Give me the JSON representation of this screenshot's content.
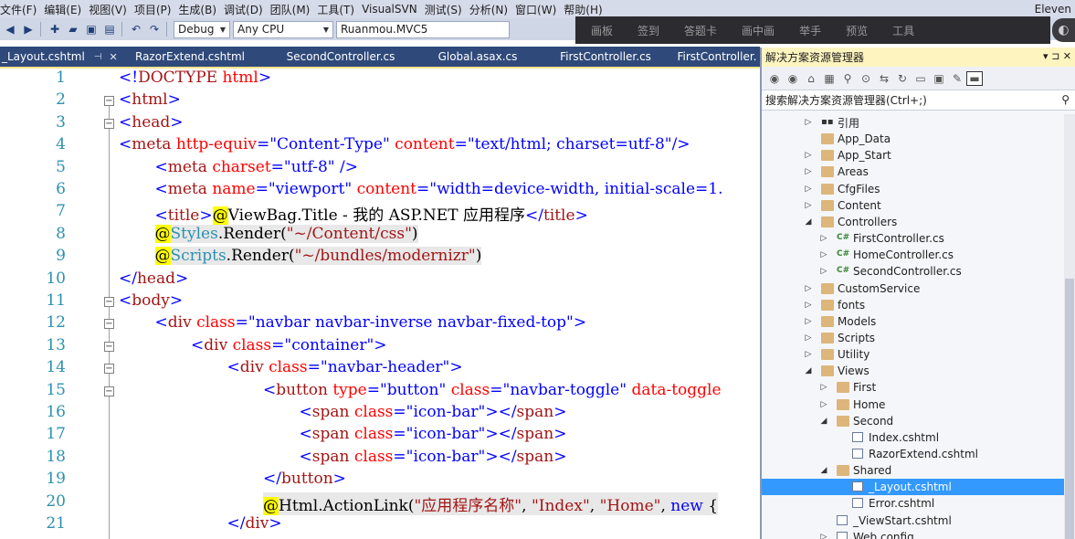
{
  "menu": {
    "items": [
      "文件(F)",
      "编辑(E)",
      "视图(V)",
      "项目(P)",
      "生成(B)",
      "调试(D)",
      "团队(M)",
      "工具(T)",
      "VisualSVN",
      "测试(S)",
      "分析(N)",
      "窗口(W)",
      "帮助(H)"
    ],
    "user": "Eleven"
  },
  "toolbar": {
    "config": "Debug",
    "platform": "Any CPU",
    "project": "Ruanmou.MVC5"
  },
  "overlay": {
    "items": [
      "画板",
      "签到",
      "答题卡",
      "画中画",
      "举手",
      "预览",
      "工具"
    ]
  },
  "tabs": [
    {
      "label": "_Layout.cshtml",
      "active": true
    },
    {
      "label": "RazorExtend.cshtml"
    },
    {
      "label": "SecondController.cs"
    },
    {
      "label": "Global.asax.cs"
    },
    {
      "label": "FirstController.cs"
    },
    {
      "label": "FirstController."
    }
  ],
  "editor": {
    "lines": [
      {
        "n": "1",
        "indent": 0,
        "fold": "",
        "tokens": [
          [
            "c-br",
            "<!"
          ],
          [
            "c-tag",
            "DOCTYPE"
          ],
          [
            "c-txt",
            " "
          ],
          [
            "c-attr",
            "html"
          ],
          [
            "c-br",
            ">"
          ]
        ]
      },
      {
        "n": "2",
        "indent": 0,
        "fold": "⊟",
        "tokens": [
          [
            "c-br",
            "<"
          ],
          [
            "c-tag",
            "html"
          ],
          [
            "c-br",
            ">"
          ]
        ]
      },
      {
        "n": "3",
        "indent": 0,
        "fold": "⊟",
        "tokens": [
          [
            "c-br",
            "<"
          ],
          [
            "c-tag",
            "head"
          ],
          [
            "c-br",
            ">"
          ]
        ]
      },
      {
        "n": "4",
        "indent": 0,
        "fold": "",
        "tokens": [
          [
            "c-br",
            "<"
          ],
          [
            "c-tag",
            "meta"
          ],
          [
            "c-txt",
            " "
          ],
          [
            "c-attr",
            "http-equiv"
          ],
          [
            "c-br",
            "="
          ],
          [
            "c-str",
            "\"Content-Type\""
          ],
          [
            "c-txt",
            " "
          ],
          [
            "c-attr",
            "content"
          ],
          [
            "c-br",
            "="
          ],
          [
            "c-str",
            "\"text/html; charset=utf-8\""
          ],
          [
            "c-br",
            "/>"
          ]
        ]
      },
      {
        "n": "5",
        "indent": 1,
        "fold": "",
        "tokens": [
          [
            "c-br",
            "<"
          ],
          [
            "c-tag",
            "meta"
          ],
          [
            "c-txt",
            " "
          ],
          [
            "c-attr",
            "charset"
          ],
          [
            "c-br",
            "="
          ],
          [
            "c-str",
            "\"utf-8\""
          ],
          [
            "c-txt",
            " "
          ],
          [
            "c-br",
            "/>"
          ]
        ]
      },
      {
        "n": "6",
        "indent": 1,
        "fold": "",
        "tokens": [
          [
            "c-br",
            "<"
          ],
          [
            "c-tag",
            "meta"
          ],
          [
            "c-txt",
            " "
          ],
          [
            "c-attr",
            "name"
          ],
          [
            "c-br",
            "="
          ],
          [
            "c-str",
            "\"viewport\""
          ],
          [
            "c-txt",
            " "
          ],
          [
            "c-attr",
            "content"
          ],
          [
            "c-br",
            "="
          ],
          [
            "c-str",
            "\"width=device-width, initial-scale=1."
          ]
        ]
      },
      {
        "n": "7",
        "indent": 1,
        "fold": "",
        "tokens": [
          [
            "c-br",
            "<"
          ],
          [
            "c-tag",
            "title"
          ],
          [
            "c-br",
            ">"
          ],
          [
            "c-at",
            "@"
          ],
          [
            "c-txt",
            "ViewBag.Title - 我的 ASP.NET 应用程序"
          ],
          [
            "c-br",
            "</"
          ],
          [
            "c-tag",
            "title"
          ],
          [
            "c-br",
            ">"
          ]
        ]
      },
      {
        "n": "8",
        "indent": 1,
        "fold": "",
        "hl": true,
        "tokens": [
          [
            "c-at",
            "@"
          ],
          [
            "c-type",
            "Styles"
          ],
          [
            "c-txt",
            ".Render("
          ],
          [
            "c-tag",
            "\"~/Content/css\""
          ],
          [
            "c-txt",
            ")"
          ]
        ]
      },
      {
        "n": "9",
        "indent": 1,
        "fold": "",
        "hl": true,
        "tokens": [
          [
            "c-at",
            "@"
          ],
          [
            "c-type",
            "Scripts"
          ],
          [
            "c-txt",
            ".Render("
          ],
          [
            "c-tag",
            "\"~/bundles/modernizr\""
          ],
          [
            "c-txt",
            ")"
          ]
        ]
      },
      {
        "n": "10",
        "indent": 0,
        "fold": "",
        "tokens": [
          [
            "c-br",
            "</"
          ],
          [
            "c-tag",
            "head"
          ],
          [
            "c-br",
            ">"
          ]
        ]
      },
      {
        "n": "11",
        "indent": 0,
        "fold": "⊟",
        "tokens": [
          [
            "c-br",
            "<"
          ],
          [
            "c-tag",
            "body"
          ],
          [
            "c-br",
            ">"
          ]
        ]
      },
      {
        "n": "12",
        "indent": 1,
        "fold": "⊟",
        "tokens": [
          [
            "c-br",
            "<"
          ],
          [
            "c-tag",
            "div"
          ],
          [
            "c-txt",
            " "
          ],
          [
            "c-attr",
            "class"
          ],
          [
            "c-br",
            "="
          ],
          [
            "c-str",
            "\"navbar navbar-inverse navbar-fixed-top\""
          ],
          [
            "c-br",
            ">"
          ]
        ]
      },
      {
        "n": "13",
        "indent": 2,
        "fold": "⊟",
        "tokens": [
          [
            "c-br",
            "<"
          ],
          [
            "c-tag",
            "div"
          ],
          [
            "c-txt",
            " "
          ],
          [
            "c-attr",
            "class"
          ],
          [
            "c-br",
            "="
          ],
          [
            "c-str",
            "\"container\""
          ],
          [
            "c-br",
            ">"
          ]
        ]
      },
      {
        "n": "14",
        "indent": 3,
        "fold": "⊟",
        "tokens": [
          [
            "c-br",
            "<"
          ],
          [
            "c-tag",
            "div"
          ],
          [
            "c-txt",
            " "
          ],
          [
            "c-attr",
            "class"
          ],
          [
            "c-br",
            "="
          ],
          [
            "c-str",
            "\"navbar-header\""
          ],
          [
            "c-br",
            ">"
          ]
        ]
      },
      {
        "n": "15",
        "indent": 4,
        "fold": "⊟",
        "tokens": [
          [
            "c-br",
            "<"
          ],
          [
            "c-tag",
            "button"
          ],
          [
            "c-txt",
            " "
          ],
          [
            "c-attr",
            "type"
          ],
          [
            "c-br",
            "="
          ],
          [
            "c-str",
            "\"button\""
          ],
          [
            "c-txt",
            " "
          ],
          [
            "c-attr",
            "class"
          ],
          [
            "c-br",
            "="
          ],
          [
            "c-str",
            "\"navbar-toggle\""
          ],
          [
            "c-txt",
            " "
          ],
          [
            "c-attr",
            "data-toggle"
          ]
        ]
      },
      {
        "n": "16",
        "indent": 5,
        "fold": "",
        "tokens": [
          [
            "c-br",
            "<"
          ],
          [
            "c-tag",
            "span"
          ],
          [
            "c-txt",
            " "
          ],
          [
            "c-attr",
            "class"
          ],
          [
            "c-br",
            "="
          ],
          [
            "c-str",
            "\"icon-bar\""
          ],
          [
            "c-br",
            "></"
          ],
          [
            "c-tag",
            "span"
          ],
          [
            "c-br",
            ">"
          ]
        ]
      },
      {
        "n": "17",
        "indent": 5,
        "fold": "",
        "tokens": [
          [
            "c-br",
            "<"
          ],
          [
            "c-tag",
            "span"
          ],
          [
            "c-txt",
            " "
          ],
          [
            "c-attr",
            "class"
          ],
          [
            "c-br",
            "="
          ],
          [
            "c-str",
            "\"icon-bar\""
          ],
          [
            "c-br",
            "></"
          ],
          [
            "c-tag",
            "span"
          ],
          [
            "c-br",
            ">"
          ]
        ]
      },
      {
        "n": "18",
        "indent": 5,
        "fold": "",
        "tokens": [
          [
            "c-br",
            "<"
          ],
          [
            "c-tag",
            "span"
          ],
          [
            "c-txt",
            " "
          ],
          [
            "c-attr",
            "class"
          ],
          [
            "c-br",
            "="
          ],
          [
            "c-str",
            "\"icon-bar\""
          ],
          [
            "c-br",
            "></"
          ],
          [
            "c-tag",
            "span"
          ],
          [
            "c-br",
            ">"
          ]
        ]
      },
      {
        "n": "19",
        "indent": 4,
        "fold": "",
        "tokens": [
          [
            "c-br",
            "</"
          ],
          [
            "c-tag",
            "button"
          ],
          [
            "c-br",
            ">"
          ]
        ]
      },
      {
        "n": "20",
        "indent": 4,
        "fold": "",
        "hl": true,
        "tokens": [
          [
            "c-at",
            "@"
          ],
          [
            "c-txt",
            "Html.ActionLink("
          ],
          [
            "c-tag",
            "\"应用程序名称\""
          ],
          [
            "c-txt",
            ", "
          ],
          [
            "c-tag",
            "\"Index\""
          ],
          [
            "c-txt",
            ", "
          ],
          [
            "c-tag",
            "\"Home\""
          ],
          [
            "c-txt",
            ", "
          ],
          [
            "c-kw",
            "new"
          ],
          [
            "c-txt",
            " {"
          ]
        ]
      },
      {
        "n": "21",
        "indent": 3,
        "fold": "",
        "tokens": [
          [
            "c-br",
            "</"
          ],
          [
            "c-tag",
            "div"
          ],
          [
            "c-br",
            ">"
          ]
        ]
      }
    ]
  },
  "solution_explorer": {
    "title": "解决方案资源管理器",
    "title_buttons": "▾ ⊐ ✕",
    "search_placeholder": "搜索解决方案资源管理器(Ctrl+;)",
    "tree": [
      {
        "label": "引用",
        "depth": 0,
        "exp": "▷",
        "icon": "ref"
      },
      {
        "label": "App_Data",
        "depth": 0,
        "exp": "",
        "icon": "folder"
      },
      {
        "label": "App_Start",
        "depth": 0,
        "exp": "▷",
        "icon": "folder"
      },
      {
        "label": "Areas",
        "depth": 0,
        "exp": "▷",
        "icon": "folder"
      },
      {
        "label": "CfgFiles",
        "depth": 0,
        "exp": "▷",
        "icon": "folder"
      },
      {
        "label": "Content",
        "depth": 0,
        "exp": "▷",
        "icon": "folder"
      },
      {
        "label": "Controllers",
        "depth": 0,
        "exp": "◢",
        "icon": "folder"
      },
      {
        "label": "FirstController.cs",
        "depth": 1,
        "exp": "▷",
        "icon": "cs"
      },
      {
        "label": "HomeController.cs",
        "depth": 1,
        "exp": "▷",
        "icon": "cs"
      },
      {
        "label": "SecondController.cs",
        "depth": 1,
        "exp": "▷",
        "icon": "cs"
      },
      {
        "label": "CustomService",
        "depth": 0,
        "exp": "▷",
        "icon": "folder"
      },
      {
        "label": "fonts",
        "depth": 0,
        "exp": "▷",
        "icon": "folder"
      },
      {
        "label": "Models",
        "depth": 0,
        "exp": "▷",
        "icon": "folder"
      },
      {
        "label": "Scripts",
        "depth": 0,
        "exp": "▷",
        "icon": "folder"
      },
      {
        "label": "Utility",
        "depth": 0,
        "exp": "▷",
        "icon": "folder"
      },
      {
        "label": "Views",
        "depth": 0,
        "exp": "◢",
        "icon": "folder"
      },
      {
        "label": "First",
        "depth": 1,
        "exp": "▷",
        "icon": "folder"
      },
      {
        "label": "Home",
        "depth": 1,
        "exp": "▷",
        "icon": "folder"
      },
      {
        "label": "Second",
        "depth": 1,
        "exp": "◢",
        "icon": "folder"
      },
      {
        "label": "Index.cshtml",
        "depth": 2,
        "exp": "",
        "icon": "file"
      },
      {
        "label": "RazorExtend.cshtml",
        "depth": 2,
        "exp": "",
        "icon": "file"
      },
      {
        "label": "Shared",
        "depth": 1,
        "exp": "◢",
        "icon": "folder"
      },
      {
        "label": "_Layout.cshtml",
        "depth": 2,
        "exp": "",
        "icon": "file",
        "selected": true
      },
      {
        "label": "Error.cshtml",
        "depth": 2,
        "exp": "",
        "icon": "file"
      },
      {
        "label": "_ViewStart.cshtml",
        "depth": 1,
        "exp": "",
        "icon": "file"
      },
      {
        "label": "Web.config",
        "depth": 1,
        "exp": "▷",
        "icon": "file"
      }
    ]
  }
}
